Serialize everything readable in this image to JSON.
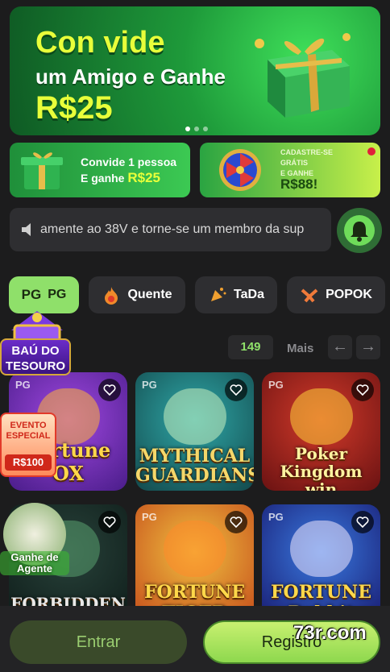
{
  "hero": {
    "line1": "Con vide",
    "line2": "um Amigo e Ganhe",
    "line3": "R$25",
    "slides_total": 3,
    "slide_active": 1
  },
  "promos": [
    {
      "line1": "Convide 1 pessoa",
      "line2_prefix": "E ganhe ",
      "amount": "R$25"
    },
    {
      "line1": "CADASTRE-SE",
      "line2": "GRÁTIS",
      "line3": "E GANHE",
      "amount": "R$88!"
    }
  ],
  "marquee": {
    "text": "amente ao 38V e torne-se um membro da sup",
    "speaker_icon": "speaker-icon",
    "bell_icon": "bell-icon"
  },
  "tabs": [
    {
      "icon": "PG",
      "label": "PG",
      "active": true
    },
    {
      "icon": "hot-icon",
      "label": "Quente",
      "active": false
    },
    {
      "icon": "tada-icon",
      "label": "TaDa",
      "active": false
    },
    {
      "icon": "popok-icon",
      "label": "POPOK",
      "active": false
    }
  ],
  "chest": {
    "label": "BAÚ DO TESOURO"
  },
  "games_header": {
    "count": "149",
    "more": "Mais",
    "prev": "←",
    "next": "→"
  },
  "games": [
    {
      "tag": "PG",
      "title": "Fortune OX"
    },
    {
      "tag": "PG",
      "title": "MYTHICAL GUARDIANS"
    },
    {
      "tag": "PG",
      "title": "Poker Kingdom win"
    },
    {
      "tag": "PG",
      "title": "FORBIDDEN ALCHEMY"
    },
    {
      "tag": "PG",
      "title": "FORTUNE TIGER"
    },
    {
      "tag": "PG",
      "title": "FORTUNE Rabbit"
    }
  ],
  "evento": {
    "title": "EVENTO ESPECIAL",
    "amount": "R$100"
  },
  "agente": {
    "text": "Ganhe de Agente"
  },
  "bottom": {
    "login": "Entrar",
    "register": "Registro"
  },
  "watermark": "73r.com",
  "colors": {
    "accent": "#8fe06a",
    "background": "#1c1c1d",
    "card": "#2e2e31"
  }
}
